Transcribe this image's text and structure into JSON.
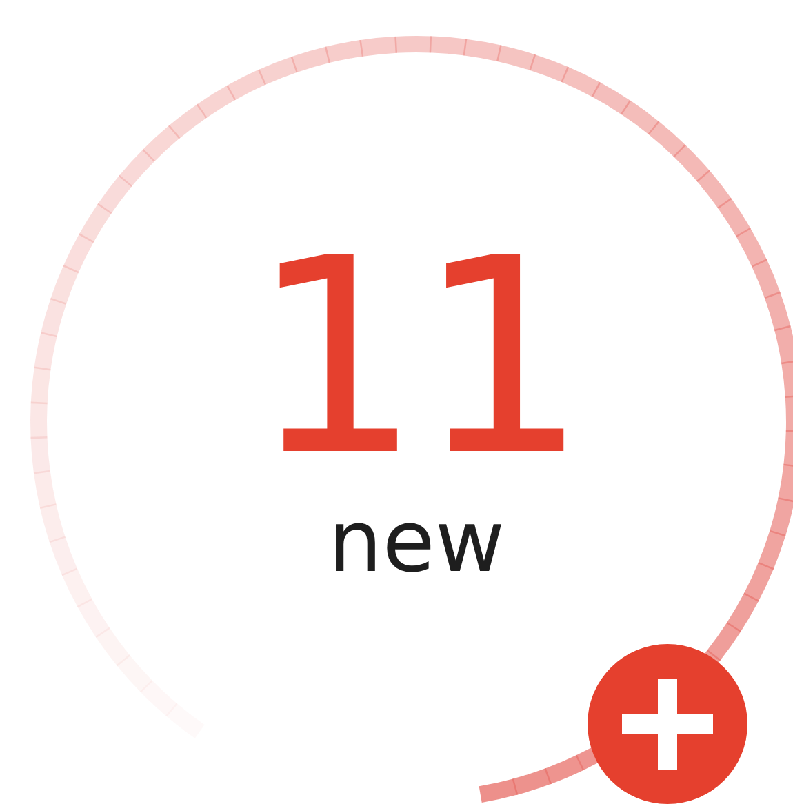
{
  "count": "11",
  "label": "new"
}
